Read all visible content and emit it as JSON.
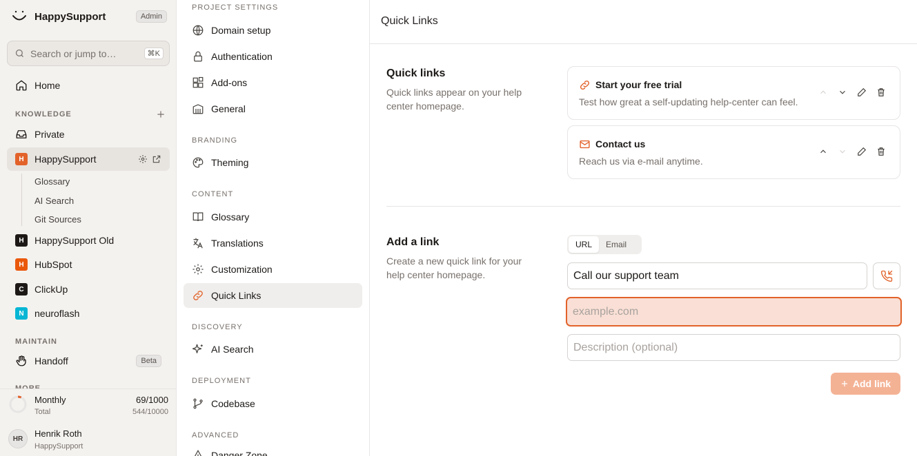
{
  "app": {
    "name": "HappySupport",
    "role_badge": "Admin"
  },
  "search": {
    "placeholder": "Search or jump to…",
    "shortcut": "⌘K"
  },
  "sidebar": {
    "home": "Home",
    "knowledge_header": "KNOWLEDGE",
    "private": "Private",
    "projects": [
      {
        "initial": "H",
        "label": "HappySupport",
        "color": "#e2622a"
      },
      {
        "initial": "H",
        "label": "HappySupport Old",
        "color": "#1c1917"
      },
      {
        "initial": "H",
        "label": "HubSpot",
        "color": "#ea580c"
      },
      {
        "initial": "C",
        "label": "ClickUp",
        "color": "#1c1917"
      },
      {
        "initial": "N",
        "label": "neuroflash",
        "color": "#06b6d4"
      }
    ],
    "sub_items": [
      "Glossary",
      "AI Search",
      "Git Sources"
    ],
    "maintain_header": "MAINTAIN",
    "handoff": "Handoff",
    "handoff_badge": "Beta",
    "more_header": "MORE"
  },
  "usage": {
    "title": "Monthly",
    "subtitle": "Total",
    "monthly": "69/1000",
    "total": "544/10000",
    "progress": 0.069
  },
  "user": {
    "initials": "HR",
    "name": "Henrik Roth",
    "org": "HappySupport"
  },
  "settings_nav": {
    "project_settings": "PROJECT SETTINGS",
    "domain_setup": "Domain setup",
    "authentication": "Authentication",
    "addons": "Add-ons",
    "general": "General",
    "branding": "BRANDING",
    "theming": "Theming",
    "content": "CONTENT",
    "glossary": "Glossary",
    "translations": "Translations",
    "customization": "Customization",
    "quick_links": "Quick Links",
    "discovery": "DISCOVERY",
    "ai_search": "AI Search",
    "deployment": "DEPLOYMENT",
    "codebase": "Codebase",
    "advanced": "ADVANCED",
    "danger_zone": "Danger Zone"
  },
  "main": {
    "title": "Quick Links",
    "quick_links": {
      "title": "Quick links",
      "description": "Quick links appear on your help center homepage.",
      "items": [
        {
          "title": "Start your free trial",
          "description": "Test how great a self-updating help-center can feel.",
          "icon": "link-icon"
        },
        {
          "title": "Contact us",
          "description": "Reach us via e-mail anytime.",
          "icon": "mail-icon"
        }
      ]
    },
    "add_link": {
      "title": "Add a link",
      "description": "Create a new quick link for your help center homepage.",
      "tabs": [
        "URL",
        "Email"
      ],
      "selected_tab": "URL",
      "title_value": "Call our support team",
      "url_placeholder": "example.com",
      "description_placeholder": "Description (optional)",
      "submit": "Add link"
    }
  },
  "colors": {
    "accent": "#e2622a",
    "accent_soft": "#f4b295",
    "error_bg": "#f9dfd5"
  }
}
